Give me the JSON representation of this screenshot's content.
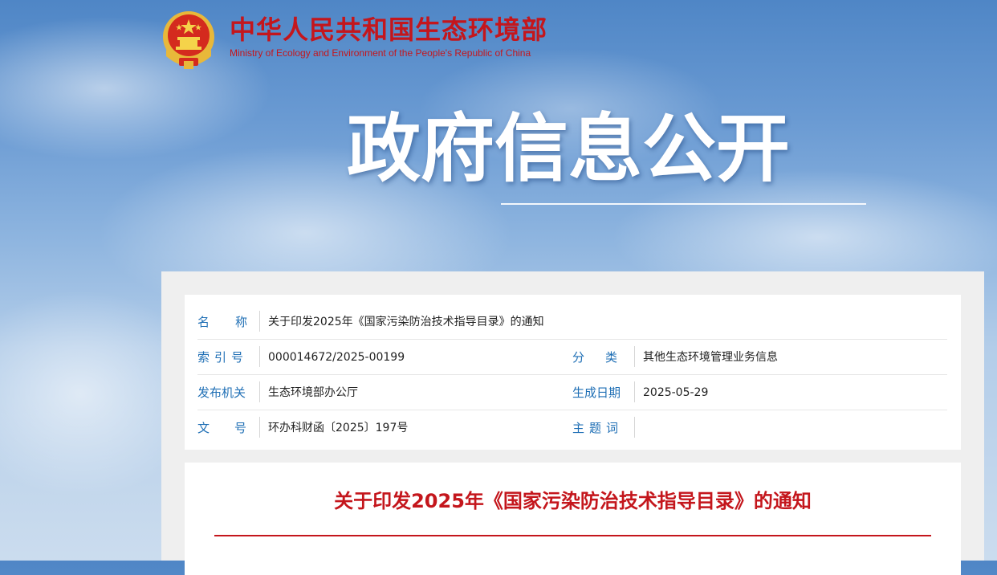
{
  "header": {
    "ministry_cn": "中华人民共和国生态环境部",
    "ministry_en": "Ministry of Ecology and Environment of the People's Republic of China"
  },
  "banner": {
    "title": "政府信息公开"
  },
  "info": {
    "name_label": "名称",
    "name_value": "关于印发2025年《国家污染防治技术指导目录》的通知",
    "index_label": "索引号",
    "index_value": "000014672/2025-00199",
    "category_label": "分类",
    "category_value": "其他生态环境管理业务信息",
    "issuer_label": "发布机关",
    "issuer_value": "生态环境部办公厅",
    "date_label": "生成日期",
    "date_value": "2025-05-29",
    "docno_label": "文号",
    "docno_value": "环办科财函〔2025〕197号",
    "subject_label": "主题词",
    "subject_value": ""
  },
  "article": {
    "title": "关于印发2025年《国家污染防治技术指导目录》的通知"
  },
  "colors": {
    "brand_red": "#c4161c",
    "label_blue": "#1f6fb5"
  }
}
